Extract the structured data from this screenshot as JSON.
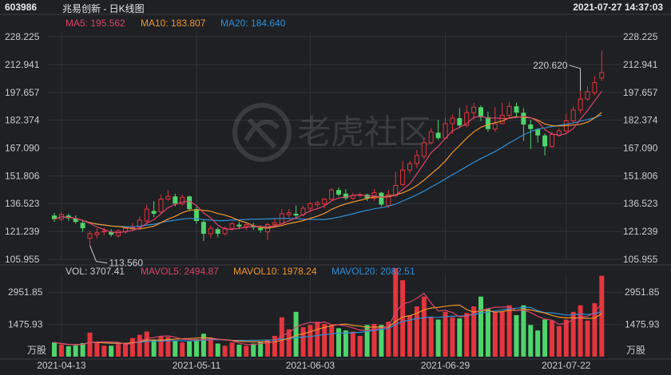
{
  "header": {
    "code": "603986",
    "name": "兆易创新 - 日K线图",
    "datetime": "2021-07-27 14:37:03"
  },
  "watermark": "老虎社区",
  "colors": {
    "up": "#e5353d",
    "down": "#4fd46c",
    "ma5": "#d9456a",
    "ma10": "#f0962f",
    "ma20": "#2f8fd8",
    "bg": "#1e2023",
    "grid": "#30333a",
    "text": "#c9ccd1"
  },
  "legend": {
    "ma5": "MA5: 195.562",
    "ma10": "MA10: 183.807",
    "ma20": "MA20: 184.640",
    "vol": "VOL: 3707.41",
    "mavol5": "MAVOL5: 2494.87",
    "mavol10": "MAVOL10: 1978.24",
    "mavol20": "MAVOL20: 2082.51"
  },
  "chart_data": {
    "type": "candlestick",
    "price_axis_labels": [
      "228.225",
      "212.941",
      "197.657",
      "182.374",
      "167.090",
      "151.806",
      "136.523",
      "121.239",
      "105.955"
    ],
    "price_range": [
      105.955,
      228.225
    ],
    "volume_axis_labels": [
      "2951.85",
      "1475.93",
      "万股"
    ],
    "volume_range": [
      0,
      3800
    ],
    "x_tick_labels": [
      "2021-04-13",
      "2021-05-11",
      "2021-06-03",
      "2021-06-29",
      "2021-07-22"
    ],
    "x_tick_indices": [
      1,
      20,
      36,
      55,
      72
    ],
    "annotations": {
      "high": "220.620",
      "low": "113.560",
      "high_index": 74,
      "low_index": 5
    },
    "candles": [
      [
        130.0,
        128.0,
        131.5,
        126.5,
        650
      ],
      [
        128.0,
        130.5,
        132.0,
        127.0,
        550
      ],
      [
        130.0,
        128.5,
        131.0,
        127.0,
        480
      ],
      [
        128.5,
        126.5,
        130.0,
        125.5,
        520
      ],
      [
        126.0,
        123.0,
        127.5,
        121.0,
        620
      ],
      [
        117.5,
        120.0,
        121.5,
        113.56,
        1100
      ],
      [
        119.5,
        120.5,
        123.0,
        117.5,
        650
      ],
      [
        121.0,
        121.5,
        123.5,
        119.0,
        500
      ],
      [
        121.0,
        119.5,
        122.5,
        118.5,
        500
      ],
      [
        119.0,
        121.5,
        122.5,
        118.0,
        580
      ],
      [
        121.0,
        123.0,
        124.0,
        120.0,
        600
      ],
      [
        123.0,
        123.5,
        126.0,
        121.5,
        850
      ],
      [
        123.5,
        127.5,
        129.5,
        122.5,
        1000
      ],
      [
        127.0,
        133.5,
        136.0,
        126.0,
        1150
      ],
      [
        132.5,
        131.0,
        138.0,
        129.0,
        750
      ],
      [
        132.0,
        139.0,
        141.5,
        131.0,
        950
      ],
      [
        139.0,
        140.5,
        144.0,
        138.0,
        900
      ],
      [
        140.5,
        136.5,
        142.0,
        135.0,
        750
      ],
      [
        136.5,
        140.0,
        141.5,
        135.5,
        650
      ],
      [
        140.5,
        133.5,
        141.0,
        132.5,
        700
      ],
      [
        133.5,
        127.0,
        135.0,
        125.5,
        800
      ],
      [
        126.5,
        120.0,
        128.0,
        116.0,
        1050
      ],
      [
        120.0,
        123.0,
        124.5,
        117.5,
        850
      ],
      [
        122.5,
        120.0,
        123.5,
        118.0,
        600
      ],
      [
        120.0,
        123.0,
        124.0,
        119.0,
        500
      ],
      [
        123.0,
        125.5,
        126.5,
        122.0,
        650
      ],
      [
        125.0,
        124.0,
        126.5,
        122.5,
        550
      ],
      [
        124.0,
        125.0,
        126.0,
        122.0,
        500
      ],
      [
        124.5,
        123.5,
        126.0,
        122.0,
        600
      ],
      [
        123.0,
        122.0,
        124.5,
        120.5,
        700
      ],
      [
        121.0,
        125.0,
        126.0,
        116.5,
        750
      ],
      [
        125.0,
        126.0,
        128.5,
        124.0,
        950
      ],
      [
        125.5,
        131.0,
        133.5,
        124.5,
        1800
      ],
      [
        130.5,
        131.5,
        133.5,
        129.0,
        1250
      ],
      [
        131.0,
        130.0,
        135.5,
        129.0,
        2050
      ],
      [
        130.5,
        134.0,
        135.5,
        129.5,
        1350
      ],
      [
        134.0,
        136.5,
        137.5,
        132.0,
        1450
      ],
      [
        136.0,
        137.0,
        138.0,
        134.5,
        1600
      ],
      [
        136.5,
        139.0,
        139.5,
        134.0,
        1500
      ],
      [
        139.0,
        144.0,
        145.0,
        138.0,
        1450
      ],
      [
        144.0,
        141.5,
        145.5,
        140.5,
        1300
      ],
      [
        142.0,
        139.5,
        144.5,
        138.5,
        1200
      ],
      [
        139.5,
        141.0,
        142.5,
        138.5,
        1150
      ],
      [
        141.0,
        141.5,
        142.5,
        140.0,
        950
      ],
      [
        141.5,
        139.5,
        142.0,
        138.0,
        1450
      ],
      [
        139.5,
        142.5,
        144.5,
        138.0,
        1500
      ],
      [
        142.5,
        136.0,
        143.0,
        135.0,
        1450
      ],
      [
        135.5,
        141.5,
        144.0,
        134.0,
        1600
      ],
      [
        141.0,
        146.5,
        154.0,
        140.0,
        4050
      ],
      [
        147.0,
        155.0,
        160.0,
        146.0,
        3500
      ],
      [
        155.0,
        158.5,
        160.0,
        153.0,
        1900
      ],
      [
        158.5,
        163.0,
        166.0,
        156.0,
        2300
      ],
      [
        162.5,
        170.0,
        172.5,
        161.0,
        2750
      ],
      [
        170.0,
        176.0,
        178.0,
        169.0,
        1800
      ],
      [
        175.5,
        172.5,
        182.5,
        171.5,
        1700
      ],
      [
        172.5,
        180.5,
        184.0,
        172.0,
        2050
      ],
      [
        180.5,
        183.5,
        185.5,
        175.0,
        1800
      ],
      [
        183.5,
        179.5,
        189.0,
        178.0,
        1750
      ],
      [
        179.5,
        186.5,
        190.5,
        178.5,
        2000
      ],
      [
        186.5,
        189.5,
        192.0,
        182.5,
        2300
      ],
      [
        189.5,
        184.0,
        190.5,
        182.0,
        2750
      ],
      [
        184.0,
        177.5,
        187.0,
        176.0,
        2200
      ],
      [
        177.5,
        180.5,
        189.5,
        176.0,
        2050
      ],
      [
        180.5,
        185.0,
        192.0,
        180.0,
        2050
      ],
      [
        185.0,
        190.0,
        192.5,
        183.5,
        2350
      ],
      [
        190.0,
        186.5,
        192.0,
        184.0,
        1900
      ],
      [
        186.5,
        180.0,
        189.0,
        171.0,
        2350
      ],
      [
        180.0,
        177.5,
        182.5,
        166.5,
        1450
      ],
      [
        177.5,
        174.0,
        178.0,
        170.0,
        1200
      ],
      [
        174.0,
        168.0,
        175.0,
        163.0,
        1700
      ],
      [
        168.0,
        174.5,
        176.0,
        167.0,
        1650
      ],
      [
        174.0,
        176.5,
        178.0,
        173.0,
        1400
      ],
      [
        176.5,
        182.0,
        186.0,
        175.5,
        1700
      ],
      [
        182.0,
        188.0,
        190.0,
        180.5,
        2050
      ],
      [
        188.0,
        194.0,
        198.5,
        186.0,
        2350
      ],
      [
        194.0,
        198.0,
        201.0,
        193.0,
        1650
      ],
      [
        197.5,
        203.0,
        206.5,
        196.0,
        2450
      ],
      [
        205.5,
        208.5,
        220.62,
        204.0,
        3707.41
      ]
    ]
  }
}
